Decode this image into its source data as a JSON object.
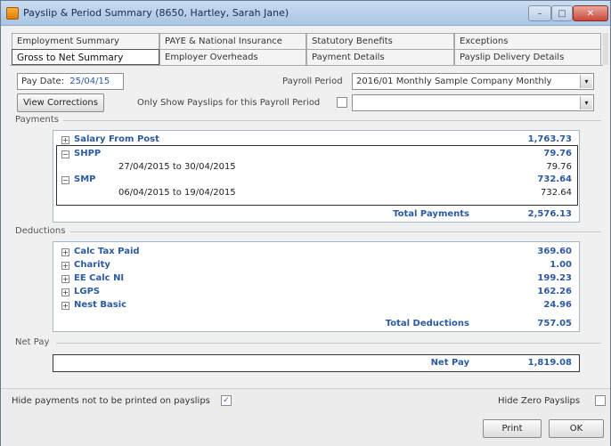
{
  "window": {
    "title": "Payslip & Period Summary (8650, Hartley, Sarah Jane)",
    "minimize": "–",
    "maximize": "□",
    "close": "✕"
  },
  "tabs": {
    "row1": [
      "Employment Summary",
      "PAYE & National Insurance",
      "Statutory Benefits",
      "Exceptions"
    ],
    "row2": [
      "Gross to Net Summary",
      "Employer Overheads",
      "Payment Details",
      "Payslip Delivery Details"
    ]
  },
  "header": {
    "pay_date_label": "Pay Date:",
    "pay_date_value": "25/04/15",
    "payroll_period_label": "Payroll Period",
    "payroll_period_value": "2016/01 Monthly Sample Company Monthly",
    "view_corrections": "View Corrections",
    "only_show_label": "Only Show Payslips for this Payroll Period",
    "only_show_value": ""
  },
  "payments": {
    "section": "Payments",
    "salary_label": "Salary From Post",
    "salary_amount": "1,763.73",
    "shpp_label": "SHPP",
    "shpp_amount": "79.76",
    "shpp_period": "27/04/2015 to 30/04/2015",
    "shpp_period_amount": "79.76",
    "smp_label": "SMP",
    "smp_amount": "732.64",
    "smp_period": "06/04/2015 to 19/04/2015",
    "smp_period_amount": "732.64",
    "total_label": "Total Payments",
    "total_amount": "2,576.13"
  },
  "deductions": {
    "section": "Deductions",
    "items": [
      {
        "label": "Calc Tax Paid",
        "amount": "369.60"
      },
      {
        "label": "Charity",
        "amount": "1.00"
      },
      {
        "label": "EE Calc NI",
        "amount": "199.23"
      },
      {
        "label": "LGPS",
        "amount": "162.26"
      },
      {
        "label": "Nest Basic",
        "amount": "24.96"
      }
    ],
    "total_label": "Total Deductions",
    "total_amount": "757.05"
  },
  "net_pay": {
    "section": "Net Pay",
    "label": "Net Pay",
    "amount": "1,819.08"
  },
  "footer": {
    "hide_payments_label": "Hide payments not to be printed on payslips",
    "hide_zero_label": "Hide Zero Payslips",
    "print": "Print",
    "ok": "OK"
  },
  "expander": {
    "plus": "+",
    "minus": "−"
  },
  "check_mark": "✓",
  "dropdown_arrow": "▾"
}
